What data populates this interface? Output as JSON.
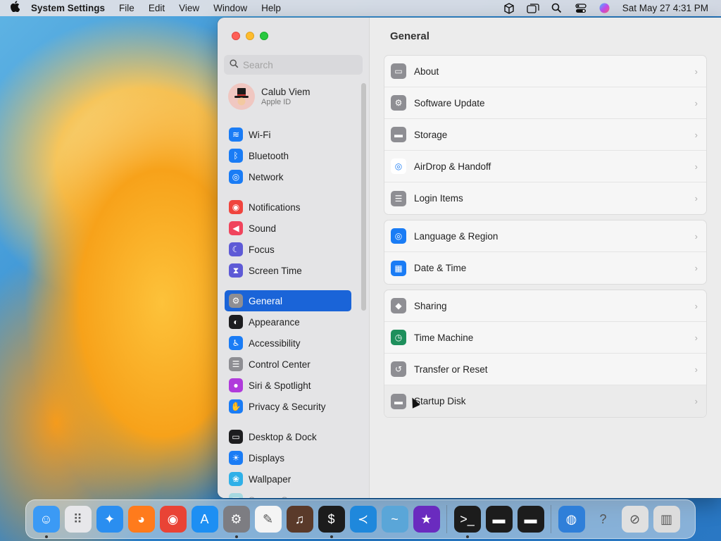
{
  "menubar": {
    "apple": "",
    "app_name": "System Settings",
    "menus": [
      "File",
      "Edit",
      "View",
      "Window",
      "Help"
    ],
    "clock": "Sat May 27  4:31 PM"
  },
  "sidebar": {
    "search_placeholder": "Search",
    "account": {
      "name": "Calub Viem",
      "subtitle": "Apple ID"
    },
    "groups": [
      [
        {
          "label": "Wi-Fi",
          "icon": "wifi-icon",
          "color": "#1a7cf5",
          "glyph": "≋"
        },
        {
          "label": "Bluetooth",
          "icon": "bluetooth-icon",
          "color": "#1a7cf5",
          "glyph": "ᛒ"
        },
        {
          "label": "Network",
          "icon": "globe-icon",
          "color": "#1a7cf5",
          "glyph": "◎"
        }
      ],
      [
        {
          "label": "Notifications",
          "icon": "bell-icon",
          "color": "#f0443e",
          "glyph": "◉"
        },
        {
          "label": "Sound",
          "icon": "speaker-icon",
          "color": "#f0445c",
          "glyph": "◀"
        },
        {
          "label": "Focus",
          "icon": "moon-icon",
          "color": "#5e5ad6",
          "glyph": "☾"
        },
        {
          "label": "Screen Time",
          "icon": "hourglass-icon",
          "color": "#5e5ad6",
          "glyph": "⧗"
        }
      ],
      [
        {
          "label": "General",
          "icon": "gear-icon",
          "color": "#8e8e93",
          "glyph": "⚙",
          "active": true
        },
        {
          "label": "Appearance",
          "icon": "appearance-icon",
          "color": "#1d1d1f",
          "glyph": "◐"
        },
        {
          "label": "Accessibility",
          "icon": "accessibility-icon",
          "color": "#1a7cf5",
          "glyph": "♿"
        },
        {
          "label": "Control Center",
          "icon": "control-center-icon",
          "color": "#8e8e93",
          "glyph": "☰"
        },
        {
          "label": "Siri & Spotlight",
          "icon": "siri-icon",
          "color": "#b03adb",
          "glyph": "●"
        },
        {
          "label": "Privacy & Security",
          "icon": "hand-icon",
          "color": "#1a7cf5",
          "glyph": "✋"
        }
      ],
      [
        {
          "label": "Desktop & Dock",
          "icon": "dock-icon",
          "color": "#1d1d1f",
          "glyph": "▭"
        },
        {
          "label": "Displays",
          "icon": "sun-icon",
          "color": "#1a7cf5",
          "glyph": "☀"
        },
        {
          "label": "Wallpaper",
          "icon": "wallpaper-icon",
          "color": "#2fb0e8",
          "glyph": "❀"
        },
        {
          "label": "Screen Saver",
          "icon": "screen-saver-icon",
          "color": "#34c7d8",
          "glyph": "▣",
          "faded": true
        }
      ]
    ]
  },
  "content": {
    "title": "General",
    "groups": [
      [
        {
          "label": "About",
          "icon": "computer-icon",
          "color": "#8e8e93",
          "glyph": "▭"
        },
        {
          "label": "Software Update",
          "icon": "gear-icon",
          "color": "#8e8e93",
          "glyph": "⚙"
        },
        {
          "label": "Storage",
          "icon": "drive-icon",
          "color": "#8e8e93",
          "glyph": "▬"
        },
        {
          "label": "AirDrop & Handoff",
          "icon": "airdrop-icon",
          "color": "#ffffff",
          "glyph": "◎",
          "dark": true
        },
        {
          "label": "Login Items",
          "icon": "list-icon",
          "color": "#8e8e93",
          "glyph": "☰"
        }
      ],
      [
        {
          "label": "Language & Region",
          "icon": "globe-icon",
          "color": "#1a7cf5",
          "glyph": "◎"
        },
        {
          "label": "Date & Time",
          "icon": "calendar-icon",
          "color": "#1a7cf5",
          "glyph": "▦"
        }
      ],
      [
        {
          "label": "Sharing",
          "icon": "sharing-icon",
          "color": "#8e8e93",
          "glyph": "◆"
        },
        {
          "label": "Time Machine",
          "icon": "time-machine-icon",
          "color": "#1e8f5c",
          "glyph": "◷"
        },
        {
          "label": "Transfer or Reset",
          "icon": "reset-icon",
          "color": "#8e8e93",
          "glyph": "↺"
        },
        {
          "label": "Startup Disk",
          "icon": "disk-icon",
          "color": "#8e8e93",
          "glyph": "▬",
          "hover": true
        }
      ]
    ]
  },
  "dock": {
    "apps": [
      {
        "name": "finder",
        "color": "#3b9af5",
        "glyph": "☺",
        "running": true
      },
      {
        "name": "launchpad",
        "color": "#e7e7ea",
        "glyph": "⠿"
      },
      {
        "name": "safari",
        "color": "#2a8ef0",
        "glyph": "✦"
      },
      {
        "name": "firefox",
        "color": "#ff7b1c",
        "glyph": "◕"
      },
      {
        "name": "chrome",
        "color": "#e94335",
        "glyph": "◉"
      },
      {
        "name": "app-store",
        "color": "#1d8ff3",
        "glyph": "A"
      },
      {
        "name": "system-settings",
        "color": "#7d7d82",
        "glyph": "⚙",
        "running": true
      },
      {
        "name": "textedit",
        "color": "#f4f4f4",
        "glyph": "✎"
      },
      {
        "name": "instruments",
        "color": "#5a3a2a",
        "glyph": "♫"
      },
      {
        "name": "terminal",
        "color": "#1c1c1c",
        "glyph": "$",
        "running": true
      },
      {
        "name": "vscode",
        "color": "#1f88dc",
        "glyph": "≺"
      },
      {
        "name": "mysql-workbench",
        "color": "#5aa6d8",
        "glyph": "~"
      },
      {
        "name": "imovie",
        "color": "#6a2bbf",
        "glyph": "★"
      },
      {
        "sep": true
      },
      {
        "name": "terminal-2",
        "color": "#1c1c1c",
        "glyph": ">_",
        "running": true
      },
      {
        "name": "exec-1",
        "color": "#1c1c1c",
        "glyph": "▬"
      },
      {
        "name": "exec-2",
        "color": "#1c1c1c",
        "glyph": "▬"
      },
      {
        "sep": true
      },
      {
        "name": "network-globe",
        "color": "#2f7fd9",
        "glyph": "◍"
      },
      {
        "name": "help",
        "color": "transparent",
        "glyph": "?"
      },
      {
        "name": "disk-utility",
        "color": "#e0e0e0",
        "glyph": "⊘"
      },
      {
        "name": "trash",
        "color": "#dcdcdc",
        "glyph": "▥"
      }
    ]
  }
}
